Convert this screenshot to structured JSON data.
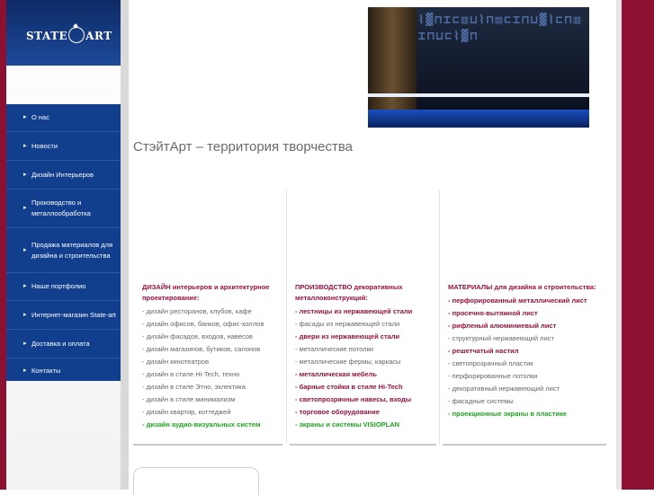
{
  "logo": {
    "text_left": "STATE",
    "text_right": "ART"
  },
  "nav": [
    {
      "id": "about",
      "label": "О нас"
    },
    {
      "id": "news",
      "label": "Новости"
    },
    {
      "id": "interior",
      "label": "Дизайн Интерьеров"
    },
    {
      "id": "production",
      "label": "Производство и металлообработка"
    },
    {
      "id": "materials",
      "label": "Продажа материалов для дизайна и строительства"
    },
    {
      "id": "portfolio",
      "label": "Наше портфолио"
    },
    {
      "id": "shop",
      "label": "Интернет-магазин State-art"
    },
    {
      "id": "delivery",
      "label": "Доставка и оплата"
    },
    {
      "id": "contacts",
      "label": "Контакты"
    }
  ],
  "tagline": "СтэйтАрт – территория творчества",
  "columns": [
    {
      "heading": "ДИЗАЙН интерьеров и архитектурное проектирование:",
      "items": [
        {
          "text": "- дизайн ресторанов, клубов, кафе",
          "style": "normal"
        },
        {
          "text": "- дизайн офисов, банков, офис-холлов",
          "style": "normal"
        },
        {
          "text": "- дизайн фасадов, входов, навесов",
          "style": "normal"
        },
        {
          "text": "- дизайн магазинов, бутиков, салонов",
          "style": "normal"
        },
        {
          "text": "- дизайн кинотеатров",
          "style": "normal"
        },
        {
          "text": "- дизайн в стиле Hi-Tech, техно",
          "style": "normal"
        },
        {
          "text": "- дизайн в стиле Этно, эклектика",
          "style": "normal"
        },
        {
          "text": "- дизайн в стиле минимализм",
          "style": "normal"
        },
        {
          "text": "- дизайн квартир, коттеджей",
          "style": "normal"
        },
        {
          "text": "- дизайн аудио-визуальных систем",
          "style": "green"
        }
      ]
    },
    {
      "heading": "ПРОИЗВОДСТВО декоративных металлоконструкций:",
      "items": [
        {
          "text": "- лестницы из нержавеющей стали",
          "style": "red"
        },
        {
          "text": "- фасады из нержавеющей стали",
          "style": "normal"
        },
        {
          "text": "- двери из нержавеющей стали",
          "style": "red"
        },
        {
          "text": "- металлические потолки",
          "style": "normal"
        },
        {
          "text": "- металлические фермы, каркасы",
          "style": "normal"
        },
        {
          "text": "- металлическая мебель",
          "style": "red"
        },
        {
          "text": "- барные стойки в стиле Hi-Tech",
          "style": "red"
        },
        {
          "text": "- светопрозрачные навесы, входы",
          "style": "red"
        },
        {
          "text": "- торговое оборудование",
          "style": "red"
        },
        {
          "text": "- экраны и системы VISIOPLAN",
          "style": "green"
        }
      ]
    },
    {
      "heading": "МАТЕРИАЛЫ для дизайна и строительства:",
      "items": [
        {
          "text": "- перфорированный металлический лист",
          "style": "red"
        },
        {
          "text": "- просечно-вытяжной лист",
          "style": "red"
        },
        {
          "text": "- рифленый алюминиевый лист",
          "style": "red"
        },
        {
          "text": "- структурный нержавеющий лист",
          "style": "normal"
        },
        {
          "text": "- решетчатый настил",
          "style": "red"
        },
        {
          "text": "- светопрозрачный пластик",
          "style": "normal"
        },
        {
          "text": "- перфорированные потолки",
          "style": "normal"
        },
        {
          "text": "- декоративный нержавеющий лист",
          "style": "normal"
        },
        {
          "text": "- фасадные системы",
          "style": "normal"
        },
        {
          "text": "- проекционные экраны в пластике",
          "style": "green"
        }
      ]
    }
  ],
  "colors": {
    "accent_red": "#9a0f3b",
    "nav_blue": "#123f8d",
    "highlight_green": "#1aa51a",
    "frame_red": "#8c1030"
  }
}
